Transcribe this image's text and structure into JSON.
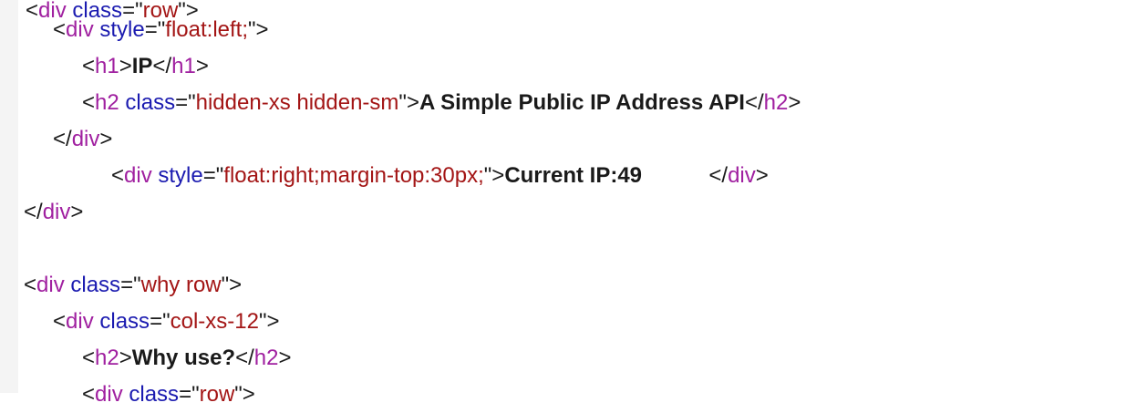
{
  "source_view": {
    "lines": [
      {
        "tokens": [
          {
            "t": "p",
            "v": "<"
          },
          {
            "t": "tag",
            "v": "div"
          },
          {
            "t": "p",
            "v": " "
          },
          {
            "t": "attr",
            "v": "class"
          },
          {
            "t": "p",
            "v": "=\""
          },
          {
            "t": "val",
            "v": "row"
          },
          {
            "t": "p",
            "v": "\">"
          }
        ]
      },
      {
        "tokens": [
          {
            "t": "p",
            "v": "<"
          },
          {
            "t": "tag",
            "v": "div"
          },
          {
            "t": "p",
            "v": " "
          },
          {
            "t": "attr",
            "v": "style"
          },
          {
            "t": "p",
            "v": "=\""
          },
          {
            "t": "val",
            "v": "float:left;"
          },
          {
            "t": "p",
            "v": "\">"
          }
        ]
      },
      {
        "tokens": [
          {
            "t": "p",
            "v": "<"
          },
          {
            "t": "tag",
            "v": "h1"
          },
          {
            "t": "p",
            "v": ">"
          },
          {
            "t": "txt",
            "v": "IP"
          },
          {
            "t": "p",
            "v": "</"
          },
          {
            "t": "tag",
            "v": "h1"
          },
          {
            "t": "p",
            "v": ">"
          }
        ]
      },
      {
        "tokens": [
          {
            "t": "p",
            "v": "<"
          },
          {
            "t": "tag",
            "v": "h2"
          },
          {
            "t": "p",
            "v": " "
          },
          {
            "t": "attr",
            "v": "class"
          },
          {
            "t": "p",
            "v": "=\""
          },
          {
            "t": "val",
            "v": "hidden-xs hidden-sm"
          },
          {
            "t": "p",
            "v": "\">"
          },
          {
            "t": "txt",
            "v": "A Simple Public IP Address API"
          },
          {
            "t": "p",
            "v": "</"
          },
          {
            "t": "tag",
            "v": "h2"
          },
          {
            "t": "p",
            "v": ">"
          }
        ]
      },
      {
        "tokens": [
          {
            "t": "p",
            "v": "</"
          },
          {
            "t": "tag",
            "v": "div"
          },
          {
            "t": "p",
            "v": ">"
          }
        ]
      },
      {
        "tokens": [
          {
            "t": "p",
            "v": "<"
          },
          {
            "t": "tag",
            "v": "div"
          },
          {
            "t": "p",
            "v": " "
          },
          {
            "t": "attr",
            "v": "style"
          },
          {
            "t": "p",
            "v": "=\""
          },
          {
            "t": "val",
            "v": "float:right;margin-top:30px;"
          },
          {
            "t": "p",
            "v": "\">"
          },
          {
            "t": "txt",
            "v": "Current IP:49           "
          },
          {
            "t": "p",
            "v": "</"
          },
          {
            "t": "tag",
            "v": "div"
          },
          {
            "t": "p",
            "v": ">"
          }
        ]
      },
      {
        "tokens": [
          {
            "t": "p",
            "v": "</"
          },
          {
            "t": "tag",
            "v": "div"
          },
          {
            "t": "p",
            "v": ">"
          }
        ]
      },
      {
        "tokens": []
      },
      {
        "tokens": [
          {
            "t": "p",
            "v": "<"
          },
          {
            "t": "tag",
            "v": "div"
          },
          {
            "t": "p",
            "v": " "
          },
          {
            "t": "attr",
            "v": "class"
          },
          {
            "t": "p",
            "v": "=\""
          },
          {
            "t": "val",
            "v": "why row"
          },
          {
            "t": "p",
            "v": "\">"
          }
        ]
      },
      {
        "tokens": [
          {
            "t": "p",
            "v": "<"
          },
          {
            "t": "tag",
            "v": "div"
          },
          {
            "t": "p",
            "v": " "
          },
          {
            "t": "attr",
            "v": "class"
          },
          {
            "t": "p",
            "v": "=\""
          },
          {
            "t": "val",
            "v": "col-xs-12"
          },
          {
            "t": "p",
            "v": "\">"
          }
        ]
      },
      {
        "tokens": [
          {
            "t": "p",
            "v": "<"
          },
          {
            "t": "tag",
            "v": "h2"
          },
          {
            "t": "p",
            "v": ">"
          },
          {
            "t": "txt",
            "v": "Why use?"
          },
          {
            "t": "p",
            "v": "</"
          },
          {
            "t": "tag",
            "v": "h2"
          },
          {
            "t": "p",
            "v": ">"
          }
        ]
      },
      {
        "tokens": [
          {
            "t": "p",
            "v": "<"
          },
          {
            "t": "tag",
            "v": "div"
          },
          {
            "t": "p",
            "v": " "
          },
          {
            "t": "attr",
            "v": "class"
          },
          {
            "t": "p",
            "v": "=\""
          },
          {
            "t": "val",
            "v": "row"
          },
          {
            "t": "p",
            "v": "\">"
          }
        ]
      }
    ]
  }
}
